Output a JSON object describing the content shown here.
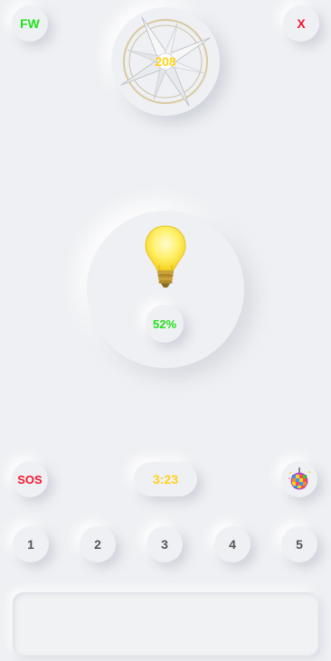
{
  "colors": {
    "green": "#22e01c",
    "red": "#f0182f",
    "yellow": "#ffd21a",
    "background": "#eff0f3"
  },
  "top_bar": {
    "left_button_label": "FW",
    "right_button_label": "X"
  },
  "compass": {
    "heading": "208",
    "icon": "compass-rose-icon"
  },
  "light": {
    "icon": "lightbulb-icon",
    "brightness_label": "52%"
  },
  "controls": {
    "sos_label": "SOS",
    "timer_label": "3:23",
    "disco_icon": "disco-ball-icon"
  },
  "number_buttons": [
    "1",
    "2",
    "3",
    "4",
    "5"
  ]
}
